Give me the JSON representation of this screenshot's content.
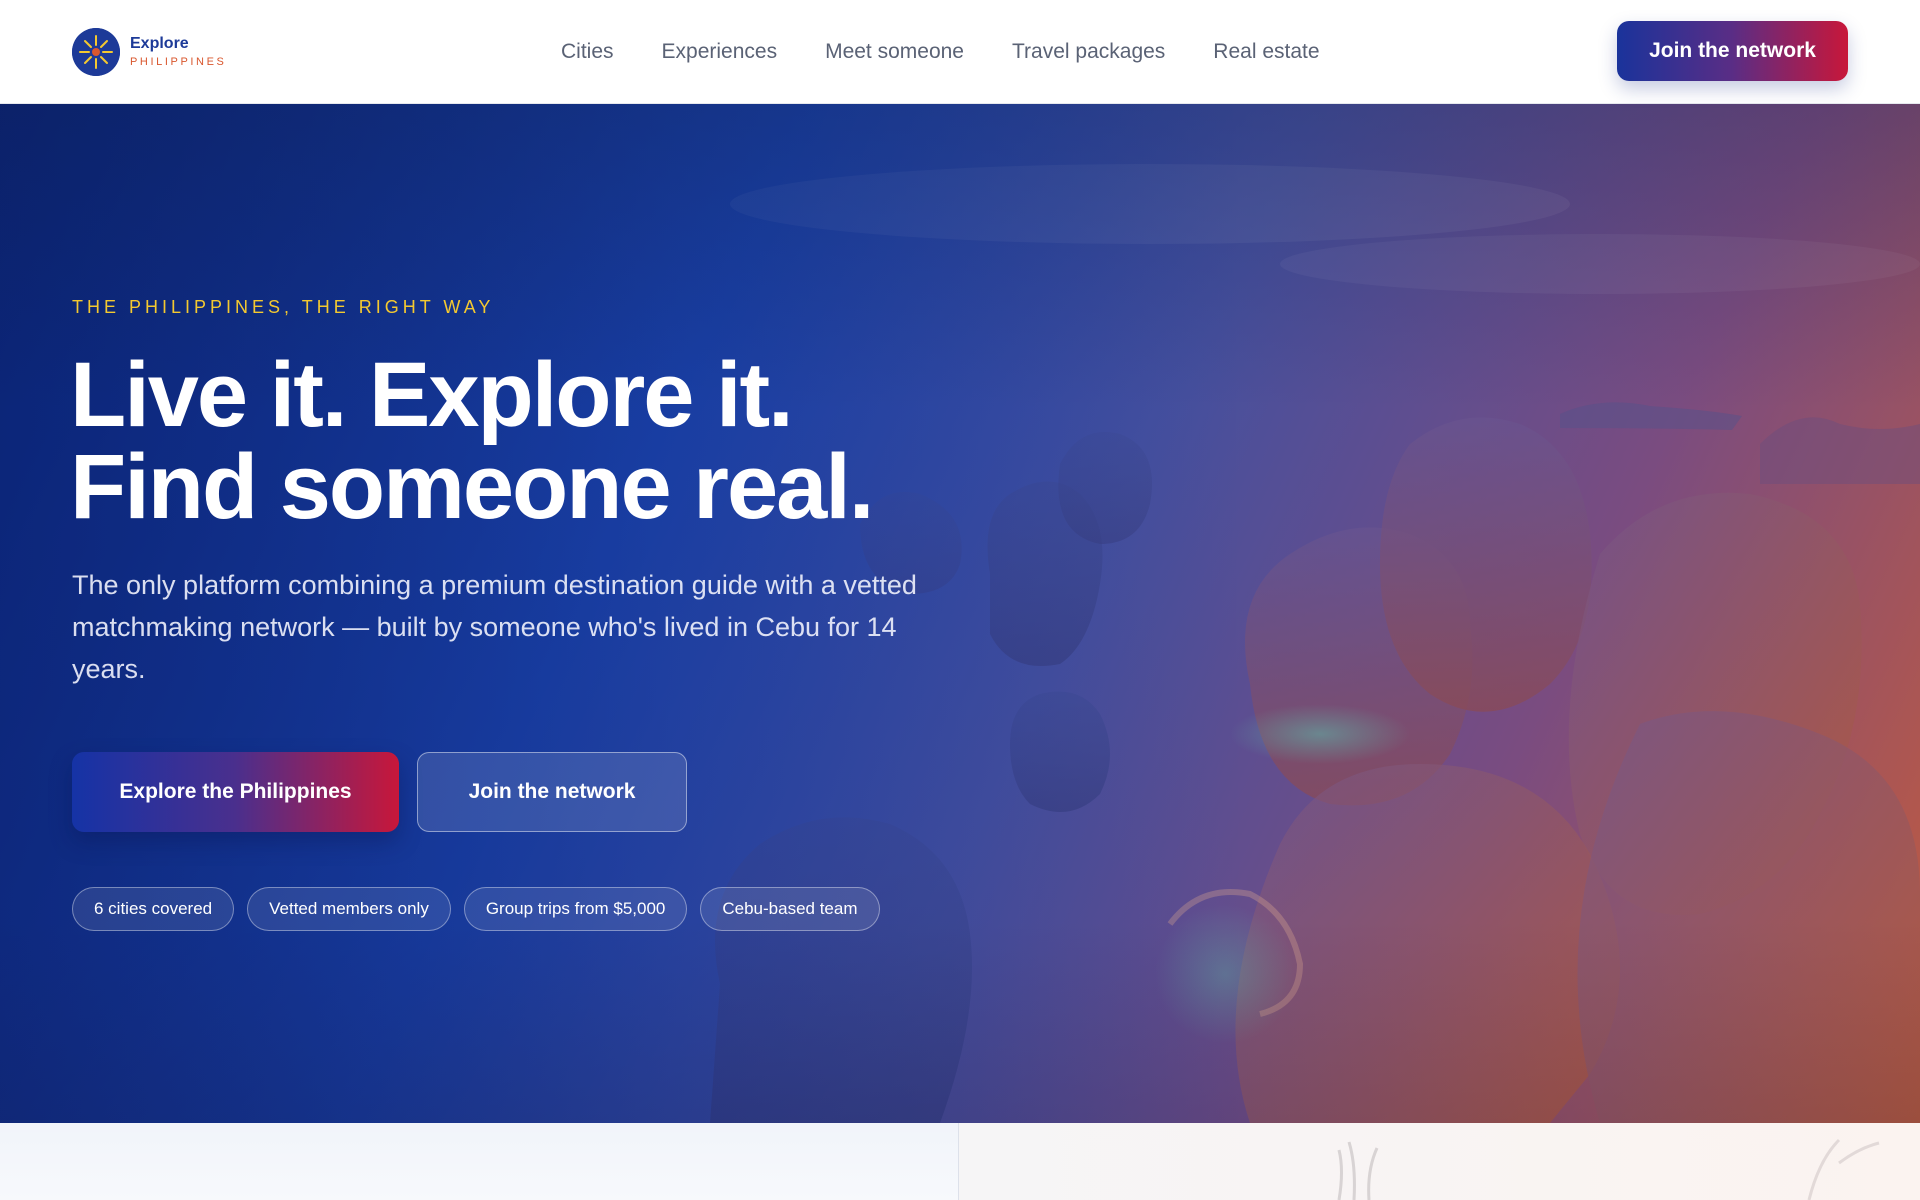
{
  "brand": {
    "name": "Explore",
    "sub": "PHILIPPINES",
    "logo_icon": "sun-compass-icon"
  },
  "nav": {
    "items": [
      {
        "label": "Cities"
      },
      {
        "label": "Experiences"
      },
      {
        "label": "Meet someone"
      },
      {
        "label": "Travel packages"
      },
      {
        "label": "Real estate"
      }
    ],
    "cta_label": "Join the network"
  },
  "hero": {
    "eyebrow": "THE PHILIPPINES, THE RIGHT WAY",
    "headline_line1": "Live it. Explore it.",
    "headline_line2": "Find someone real.",
    "lead": "The only platform combining a premium destination guide with a vetted matchmaking network — built by someone who's lived in Cebu for 14 years.",
    "primary_cta": "Explore the Philippines",
    "secondary_cta": "Join the network",
    "highlights": [
      "6 cities covered",
      "Vetted members only",
      "Group trips from $5,000",
      "Cebu-based team"
    ]
  },
  "colors": {
    "brand_blue": "#1d3a98",
    "brand_orange": "#d9572e",
    "eyebrow_gold": "#f4c930",
    "cta_gradient_start": "#1a339b",
    "cta_gradient_end": "#c8173a"
  }
}
